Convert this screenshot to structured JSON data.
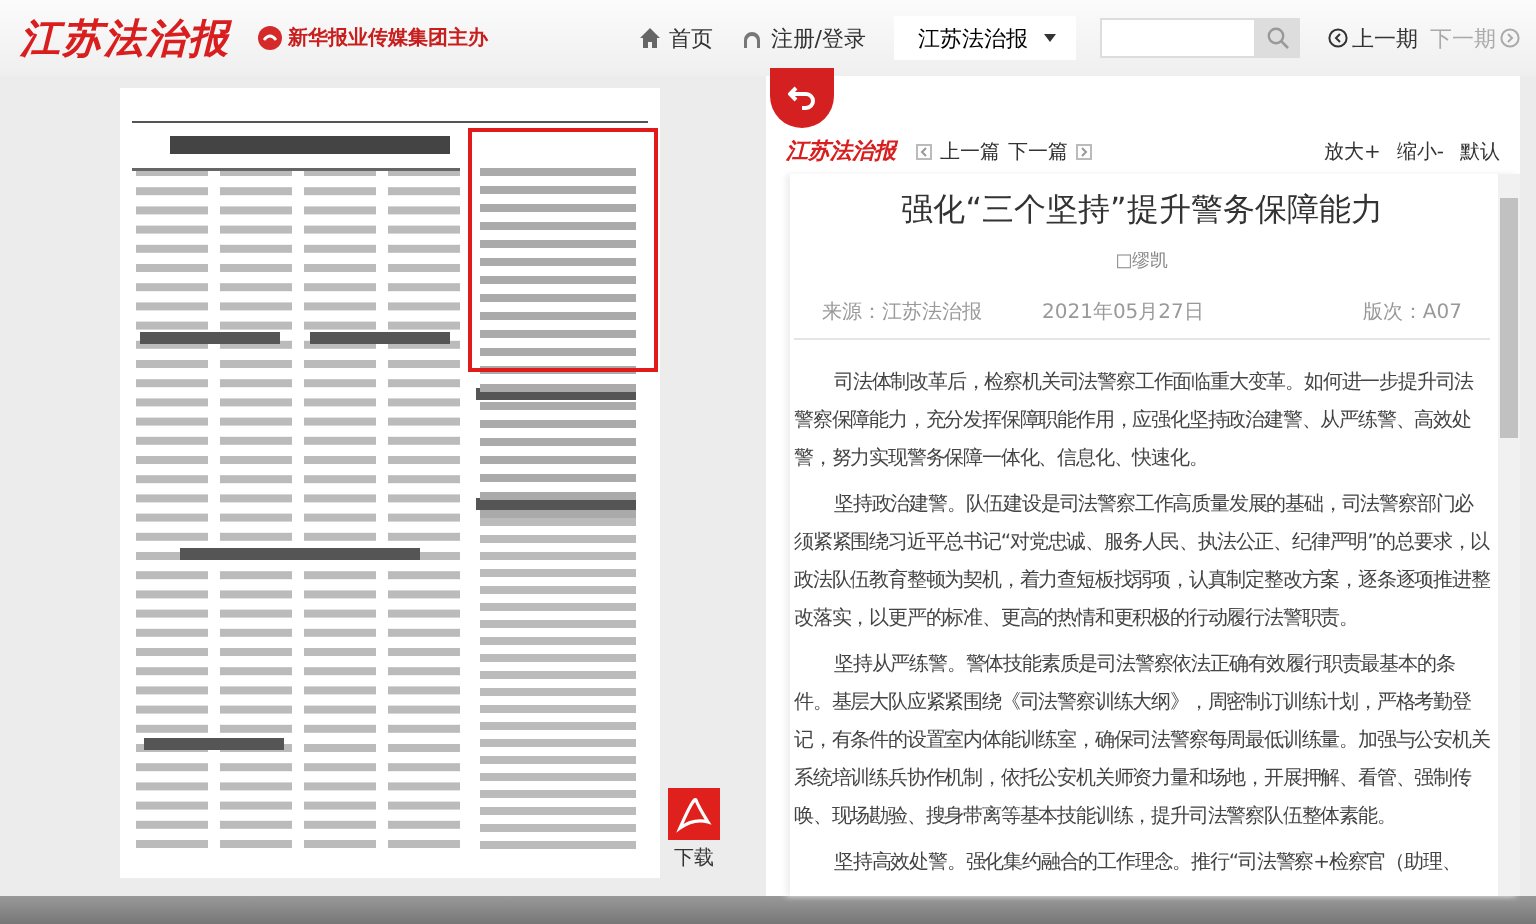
{
  "header": {
    "logo": "江苏法治报",
    "publisher": "新华报业传媒集团主办",
    "nav": [
      {
        "kind": "home",
        "label": "首页"
      },
      {
        "kind": "user",
        "label": "注册/登录"
      }
    ],
    "edition_select": "江苏法治报",
    "issue_nav": [
      {
        "kind": "prev",
        "label": "上一期",
        "disabled": false
      },
      {
        "kind": "next",
        "label": "下一期",
        "disabled": true
      }
    ]
  },
  "download": {
    "label": "下载"
  },
  "reader": {
    "logo": "江苏法治报",
    "article_nav": [
      "上一篇",
      "下一篇"
    ],
    "zoom_controls": [
      "放大+",
      "缩小-",
      "默认"
    ]
  },
  "article": {
    "title": "强化“三个坚持”提升警务保障能力",
    "author": "□缪凯",
    "source": "来源：江苏法治报",
    "date": "2021年05月27日",
    "page": "版次：A07",
    "paragraphs": [
      "司法体制改革后，检察机关司法警察工作面临重大变革。如何进一步提升司法警察保障能力，充分发挥保障职能作用，应强化坚持政治建警、从严练警、高效处警，努力实现警务保障一体化、信息化、快速化。",
      "坚持政治建警。队伍建设是司法警察工作高质量发展的基础，司法警察部门必须紧紧围绕习近平总书记“对党忠诚、服务人民、执法公正、纪律严明”的总要求，以政法队伍教育整顿为契机，着力查短板找弱项，认真制定整改方案，逐条逐项推进整改落实，以更严的标准、更高的热情和更积极的行动履行法警职责。",
      "坚持从严练警。警体技能素质是司法警察依法正确有效履行职责最基本的条件。基层大队应紧紧围绕《司法警察训练大纲》，周密制订训练计划，严格考勤登记，有条件的设置室内体能训练室，确保司法警察每周最低训练量。加强与公安机关系统培训练兵协作机制，依托公安机关师资力量和场地，开展押解、看管、强制传唤、现场勘验、搜身带离等基本技能训练，提升司法警察队伍整体素能。",
      "坚持高效处警。强化集约融合的工作理念。推行“司法警察+检察官（助理、"
    ]
  }
}
